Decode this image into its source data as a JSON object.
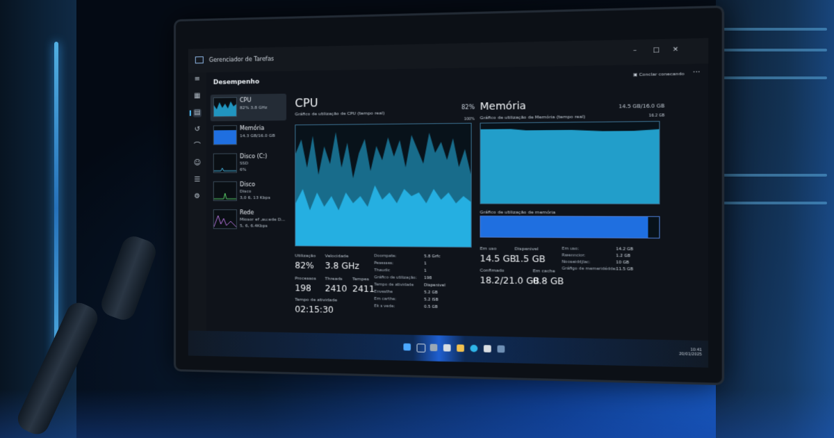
{
  "window": {
    "title": "Gerenciador de Tarefas",
    "page": "Desempenho",
    "run_task_label": "Conclar conecando",
    "more_label": "···"
  },
  "sidebar": {
    "items": [
      {
        "name": "CPU",
        "line1": "82%  3.8 GHz",
        "line2": ""
      },
      {
        "name": "Memória",
        "line1": "14.3 GB/16.0 GB",
        "line2": ""
      },
      {
        "name": "Disco (C:)",
        "line1": "SSD",
        "line2": "6%"
      },
      {
        "name": "Disco",
        "line1": "Disco",
        "line2": "3,0 6, 13 Kbps"
      },
      {
        "name": "Rede",
        "line1": "Miosor ef ,au:ede D...",
        "line2": "5, 6, 6.4Kbps"
      }
    ]
  },
  "cpu": {
    "title": "CPU",
    "chart_label": "Gráfico de utilização de CPU (tempo real)",
    "percent": "82%",
    "scale": "100%",
    "stats": {
      "utilizacao_label": "Utilização",
      "utilizacao": "82%",
      "velocidade_label": "Velocidade",
      "velocidade": "3.8 GHz",
      "processos_label": "Processos",
      "processos": "198",
      "threads_label": "Threads",
      "threads": "2410",
      "handles_label": "Tempes",
      "handles": "2411",
      "tempo_label": "Tempo de atividade",
      "tempo": "02:15:30"
    },
    "details": [
      {
        "k": "Doompate:",
        "v": "5.8 Grfc"
      },
      {
        "k": "Pesesses:",
        "v": "1"
      },
      {
        "k": "Thaudic",
        "v": "1"
      },
      {
        "k": "Gráfico de utilização:",
        "v": "198"
      },
      {
        "k": "Tempo de atividade",
        "v": "Dispenivel"
      },
      {
        "k": "Envesthe",
        "v": "5.2 GB"
      },
      {
        "k": "Em carthe:",
        "v": "5.2 ISB"
      },
      {
        "k": "Ek s vede:",
        "v": "0.5 GB"
      }
    ]
  },
  "memory": {
    "title": "Memória",
    "chart_label": "Gráfico de utilização de Memória (tempo real)",
    "total": "14.5 GB/16.0 GB",
    "scale": "16.2 GB",
    "composition_label": "Gráfico de utilização de memória",
    "stats": {
      "em_uso_label": "Em uso",
      "em_uso": "14.5 GB",
      "disponivel_label": "Dispenivel",
      "disponivel": "1.5 GB",
      "confirmado_label": "Confimado",
      "confirmado": "18.2/21.0 GB",
      "em_cache_label": "Em cache",
      "em_cache": "0.8 GB"
    },
    "details": [
      {
        "k": "Em uso:",
        "v": "14.2 GB"
      },
      {
        "k": "Rwenncior:",
        "v": "1.2 GB"
      },
      {
        "k": "Nooseiddjlac:",
        "v": "10 GB"
      },
      {
        "k": "Gráfigo de memeridédde:",
        "v": "11.5 GB"
      }
    ]
  },
  "tray": {
    "time": "10:41",
    "date": "20/01/2025"
  },
  "colors": {
    "accent": "#4cc2ff",
    "chart_fill": "#27b7ea",
    "mem_fill": "#1f6fe0",
    "bg_top": "#07182e"
  }
}
